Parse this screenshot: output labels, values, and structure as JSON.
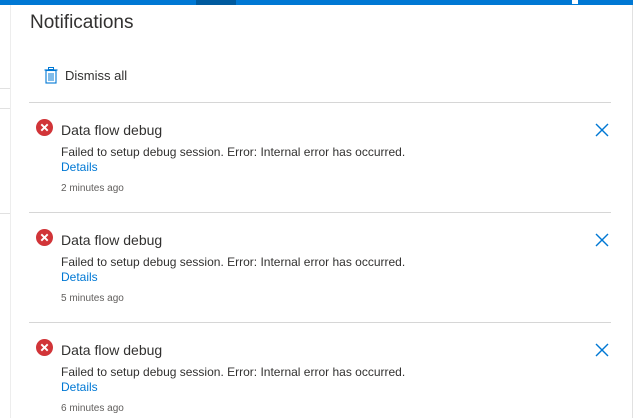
{
  "panel": {
    "title": "Notifications",
    "dismiss_all_label": "Dismiss all"
  },
  "colors": {
    "accent": "#0078d4",
    "error": "#d13438",
    "text": "#323130",
    "muted": "#605e5c"
  },
  "icons": {
    "dismiss": "trash-icon",
    "status": "error-icon",
    "close": "close-icon"
  },
  "notifications": [
    {
      "title": "Data flow debug",
      "message": "Failed to setup debug session. Error: Internal error has occurred.",
      "link_label": "Details",
      "time": "2 minutes ago"
    },
    {
      "title": "Data flow debug",
      "message": "Failed to setup debug session. Error: Internal error has occurred.",
      "link_label": "Details",
      "time": "5 minutes ago"
    },
    {
      "title": "Data flow debug",
      "message": "Failed to setup debug session. Error: Internal error has occurred.",
      "link_label": "Details",
      "time": "6 minutes ago"
    }
  ]
}
